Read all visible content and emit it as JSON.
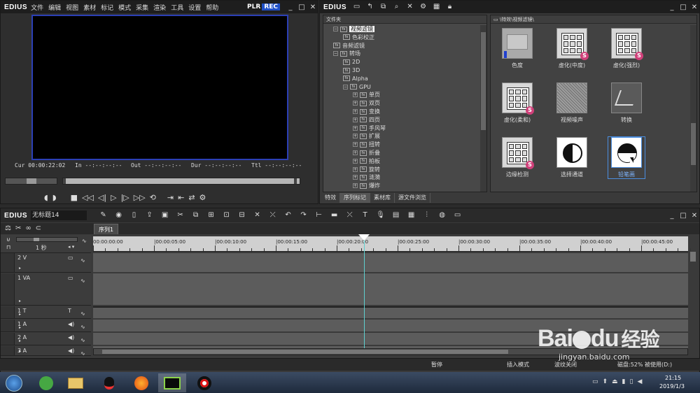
{
  "player": {
    "logo": "EDIUS",
    "menu": [
      "文件",
      "编辑",
      "视图",
      "素材",
      "标记",
      "模式",
      "采集",
      "渲染",
      "工具",
      "设置",
      "帮助"
    ],
    "plr": "PLR",
    "rec": "REC",
    "cur_label": "Cur",
    "cur_value": "00:00:22:02",
    "in_label": "In",
    "in_value": "--:--:--:--",
    "out_label": "Out",
    "out_value": "--:--:--:--",
    "dur_label": "Dur",
    "dur_value": "--:--:--:--",
    "ttl_label": "Ttl",
    "ttl_value": "--:--:--:--"
  },
  "library": {
    "logo": "EDIUS",
    "folder_header": "文件夹",
    "path": "\\特效\\视频滤镜\\",
    "tree": [
      {
        "label": "视频滤镜",
        "indent": 1,
        "selected": true
      },
      {
        "label": "色彩校正",
        "indent": 2
      },
      {
        "label": "音频滤镜",
        "indent": 1
      },
      {
        "label": "转场",
        "indent": 1
      },
      {
        "label": "2D",
        "indent": 2
      },
      {
        "label": "3D",
        "indent": 2
      },
      {
        "label": "Alpha",
        "indent": 2
      },
      {
        "label": "GPU",
        "indent": 2
      },
      {
        "label": "单页",
        "indent": 3
      },
      {
        "label": "双页",
        "indent": 3
      },
      {
        "label": "变换",
        "indent": 3
      },
      {
        "label": "四页",
        "indent": 3
      },
      {
        "label": "手风琴",
        "indent": 3
      },
      {
        "label": "扩展",
        "indent": 3
      },
      {
        "label": "扭转",
        "indent": 3
      },
      {
        "label": "折叠",
        "indent": 3
      },
      {
        "label": "拍板",
        "indent": 3
      },
      {
        "label": "旋转",
        "indent": 3
      },
      {
        "label": "涟漪",
        "indent": 3
      },
      {
        "label": "爆炸",
        "indent": 3
      }
    ],
    "effects": [
      {
        "label": "色度",
        "kind": "chroma"
      },
      {
        "label": "虚化(中度)",
        "kind": "grid"
      },
      {
        "label": "虚化(强烈)",
        "kind": "grid"
      },
      {
        "label": "虚化(柔和)",
        "kind": "grid"
      },
      {
        "label": "视频噪声",
        "kind": "noise"
      },
      {
        "label": "转换",
        "kind": "transform"
      },
      {
        "label": "边缘检测",
        "kind": "grid"
      },
      {
        "label": "选择通道",
        "kind": "channel"
      },
      {
        "label": "铅笔画",
        "kind": "pencil",
        "selected": true
      }
    ],
    "tabs": [
      "特效",
      "序列标记",
      "素材库",
      "源文件浏览"
    ]
  },
  "timeline": {
    "logo": "EDIUS",
    "project": "无标题14",
    "sequence_tab": "序列1",
    "scale": "1 秒",
    "ruler": [
      "00:00:00:00",
      "|00:00:05:00",
      "|00:00:10:00",
      "|00:00:15:00",
      "|00:00:20:00",
      "|00:00:25:00",
      "|00:00:30:00",
      "|00:00:35:00",
      "|00:00:40:00",
      "|00:00:45:00"
    ],
    "tracks": [
      {
        "name": "2 V",
        "type": "V"
      },
      {
        "name": "1 VA",
        "type": "VA"
      },
      {
        "name": "1 T",
        "type": "T"
      },
      {
        "name": "1 A",
        "type": "A"
      },
      {
        "name": "2 A",
        "type": "A"
      },
      {
        "name": "3 A",
        "type": "A"
      }
    ],
    "playhead_fraction": 0.455
  },
  "status": {
    "state": "暂停",
    "mode": "插入模式",
    "ripple": "波纹关闭",
    "disk": "磁盘:52% 被使用(D:)"
  },
  "taskbar": {
    "time": "21:15",
    "date": "2019/1/3"
  },
  "watermark": {
    "brand": "Bai",
    "brand_tail": "du",
    "brand_cn": "经验",
    "url": "jingyan.baidu.com"
  }
}
